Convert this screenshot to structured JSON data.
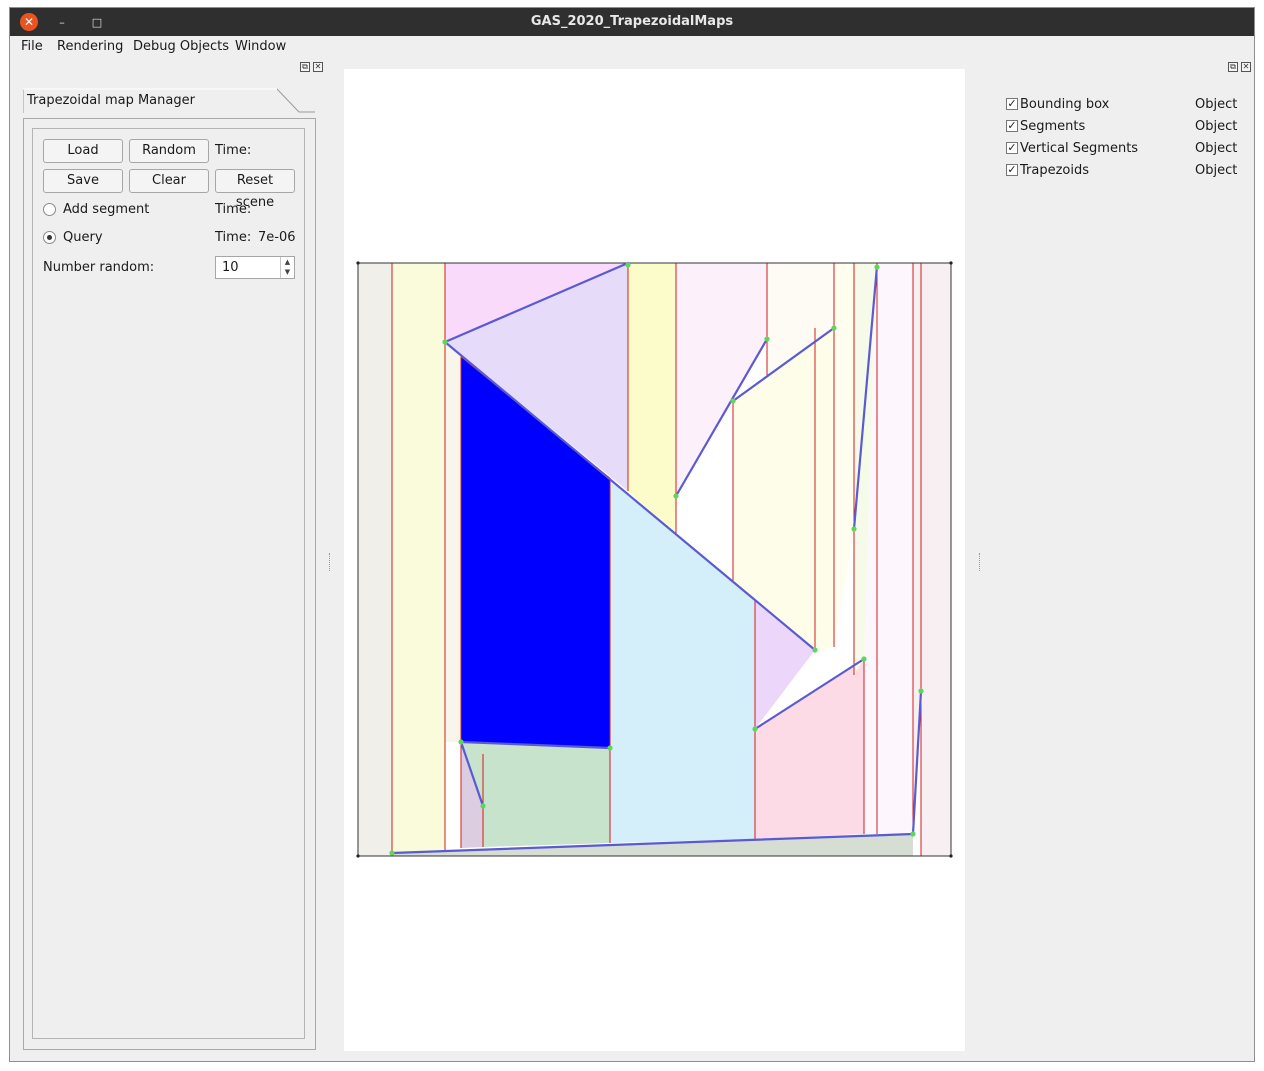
{
  "window": {
    "title": "GAS_2020_TrapezoidalMaps",
    "close_glyph": "✕",
    "minimize_glyph": "–",
    "maximize_glyph": "□"
  },
  "menu": [
    "File",
    "Rendering",
    "Debug Objects",
    "Window"
  ],
  "dock_controls": {
    "float_glyph": "⧉",
    "close_glyph": "✕"
  },
  "manager": {
    "tab_title": "Trapezoidal map Manager",
    "load_label": "Load",
    "random_label": "Random",
    "time_label_1": "Time:",
    "save_label": "Save",
    "clear_label": "Clear",
    "reset_label": "Reset scene",
    "add_segment_label": "Add segment",
    "time_label_2": "Time:",
    "query_label": "Query",
    "time_label_3": "Time:",
    "query_time_value": "7e-06",
    "number_random_label": "Number random:",
    "number_random_value": "10",
    "mode": "query",
    "spin_up_glyph": "▲",
    "spin_down_glyph": "▼"
  },
  "objects": [
    {
      "name": "Bounding box",
      "type": "Object",
      "checked": true
    },
    {
      "name": "Segments",
      "type": "Object",
      "checked": true
    },
    {
      "name": "Vertical Segments",
      "type": "Object",
      "checked": true
    },
    {
      "name": "Trapezoids",
      "type": "Object",
      "checked": true
    }
  ],
  "checkbox_glyph": "✓",
  "colors": {
    "segment": "#5a5ad2",
    "vertical_segment": "#d21e1e",
    "endpoint": "#5fd45f",
    "selected_trapezoid": "#0000ff",
    "title_bar": "#2f2f2f",
    "close_button": "#e95420"
  }
}
